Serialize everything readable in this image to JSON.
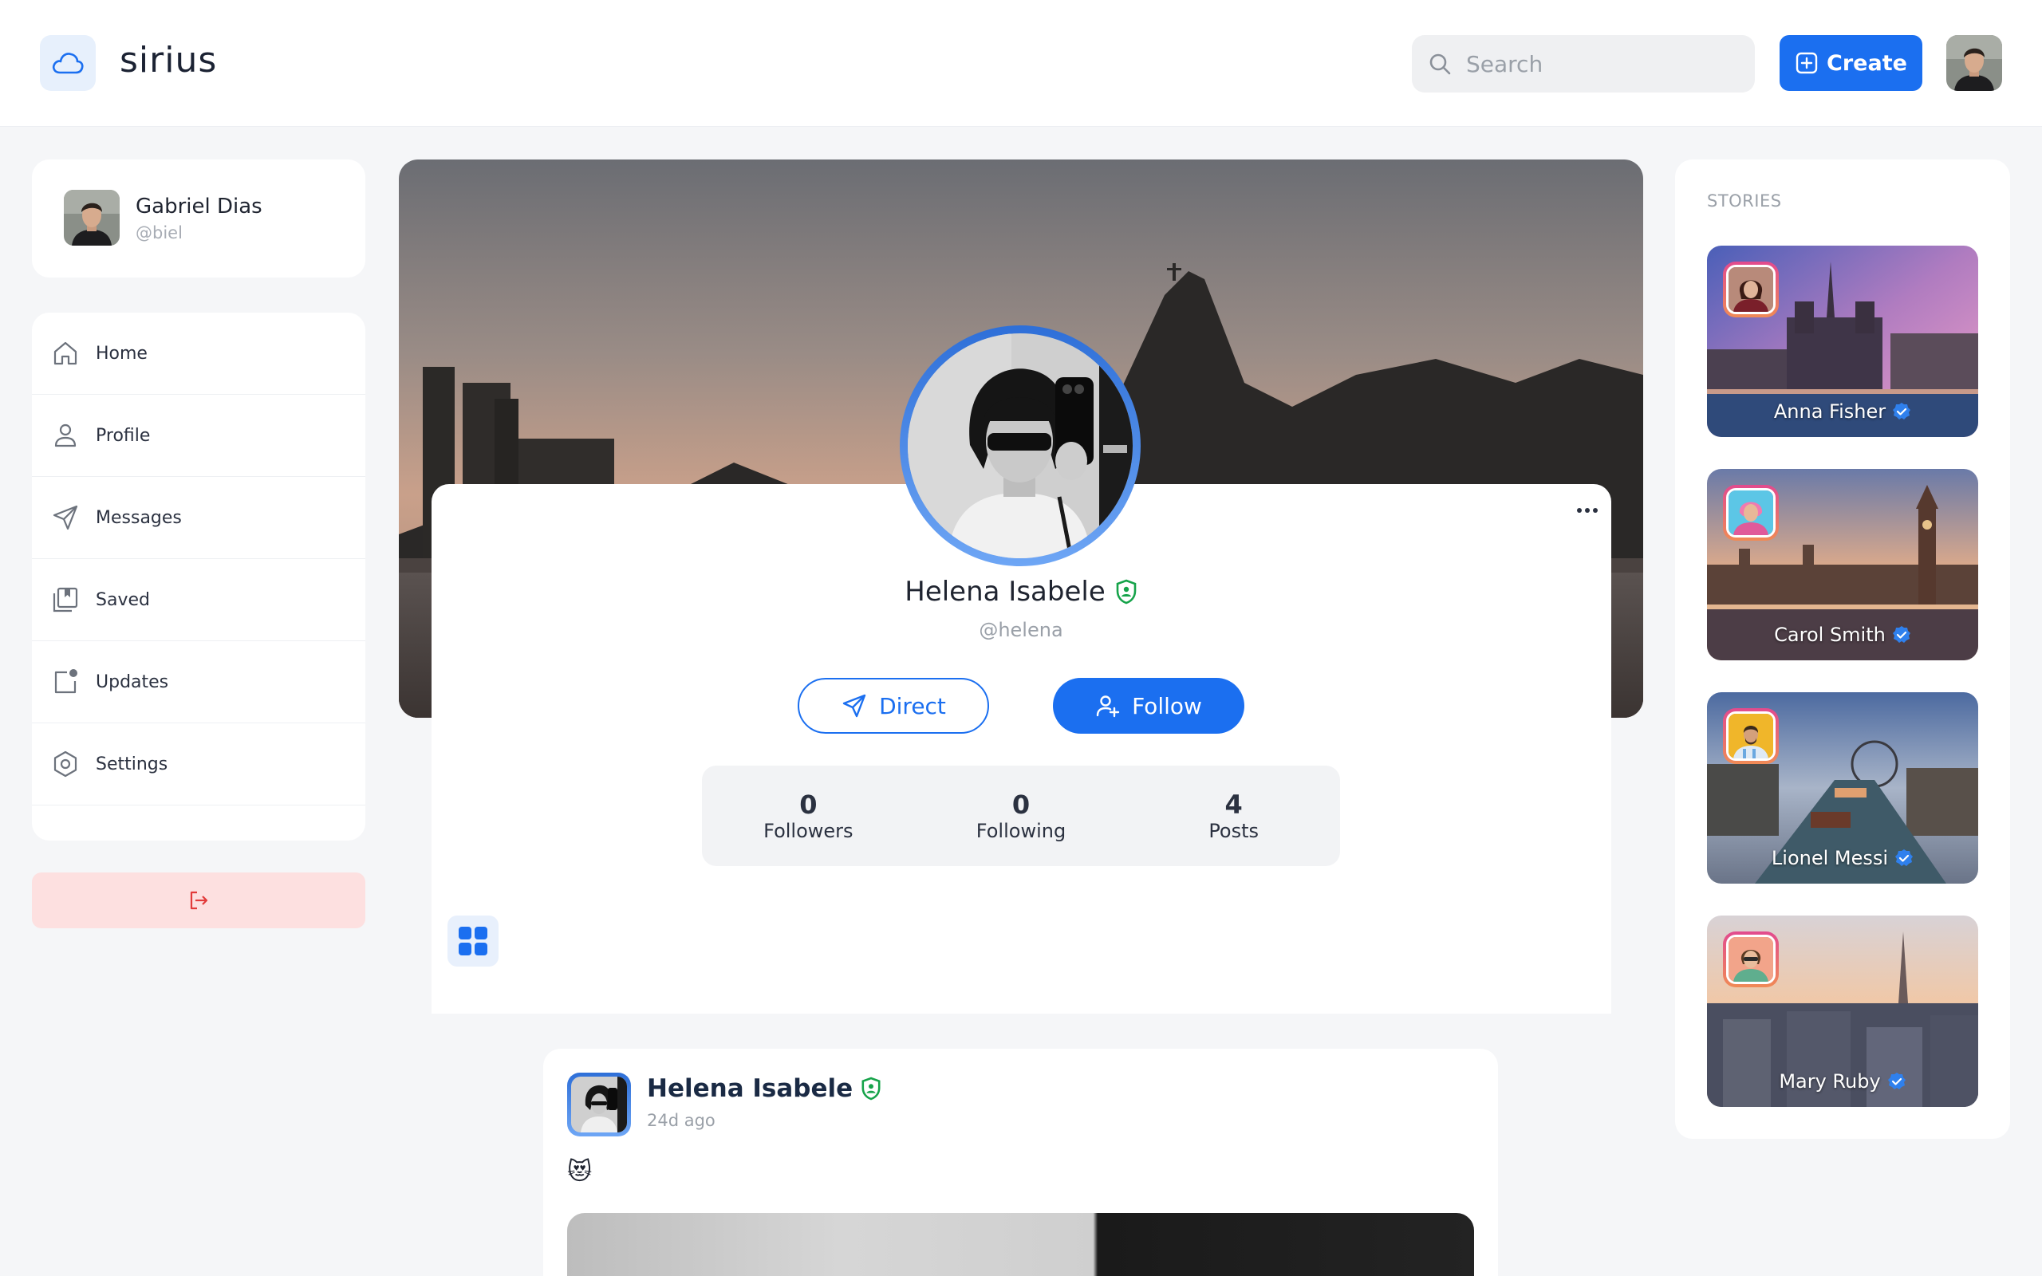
{
  "header": {
    "brand": "sirius",
    "search_placeholder": "Search",
    "create_label": "Create"
  },
  "sidebar": {
    "user": {
      "name": "Gabriel Dias",
      "handle": "@biel"
    },
    "items": [
      {
        "label": "Home",
        "icon": "home-icon"
      },
      {
        "label": "Profile",
        "icon": "user-icon"
      },
      {
        "label": "Messages",
        "icon": "send-icon"
      },
      {
        "label": "Saved",
        "icon": "bookmark-icon"
      },
      {
        "label": "Updates",
        "icon": "notification-icon"
      },
      {
        "label": "Settings",
        "icon": "settings-icon"
      }
    ],
    "logout_icon": "logout-icon"
  },
  "profile": {
    "name": "Helena Isabele",
    "handle": "@helena",
    "direct_label": "Direct",
    "follow_label": "Follow",
    "stats": [
      {
        "value": "0",
        "label": "Followers"
      },
      {
        "value": "0",
        "label": "Following"
      },
      {
        "value": "4",
        "label": "Posts"
      }
    ]
  },
  "post": {
    "author": "Helena Isabele",
    "time": "24d ago",
    "text": "😻"
  },
  "stories": {
    "title": "STORIES",
    "items": [
      {
        "name": "Anna Fisher"
      },
      {
        "name": "Carol Smith"
      },
      {
        "name": "Lionel Messi"
      },
      {
        "name": "Mary Ruby"
      }
    ]
  },
  "colors": {
    "accent": "#1b6ff0",
    "verified_shield": "#16a34a",
    "logout_bg": "#fde0e0"
  }
}
